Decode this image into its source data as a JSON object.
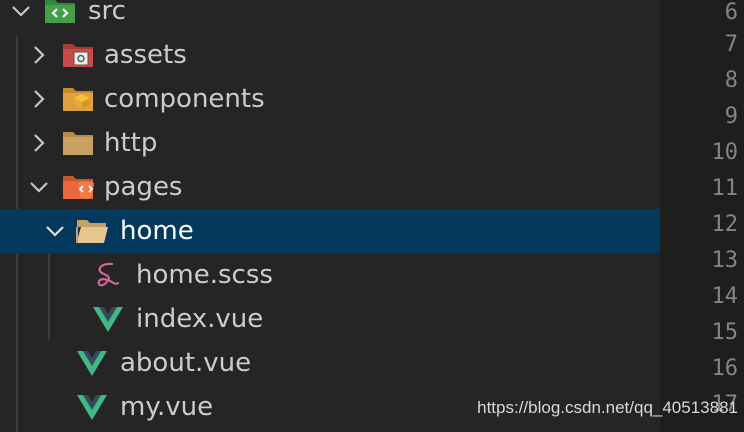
{
  "explorer": {
    "items": [
      {
        "label": "src",
        "type": "folder",
        "icon": "src-folder-icon",
        "expanded": true
      },
      {
        "label": "assets",
        "type": "folder",
        "icon": "assets-folder-icon",
        "expanded": false
      },
      {
        "label": "components",
        "type": "folder",
        "icon": "components-folder-icon",
        "expanded": false
      },
      {
        "label": "http",
        "type": "folder",
        "icon": "folder-icon",
        "expanded": false
      },
      {
        "label": "pages",
        "type": "folder",
        "icon": "pages-folder-icon",
        "expanded": true
      },
      {
        "label": "home",
        "type": "folder",
        "icon": "folder-open-icon",
        "expanded": true,
        "selected": true
      },
      {
        "label": "home.scss",
        "type": "file",
        "icon": "sass-file-icon"
      },
      {
        "label": "index.vue",
        "type": "file",
        "icon": "vue-file-icon"
      },
      {
        "label": "about.vue",
        "type": "file",
        "icon": "vue-file-icon"
      },
      {
        "label": "my.vue",
        "type": "file",
        "icon": "vue-file-icon"
      }
    ]
  },
  "gutter": {
    "line_numbers": [
      "6",
      "7",
      "8",
      "9",
      "10",
      "11",
      "12",
      "13",
      "14",
      "15",
      "16",
      "17"
    ]
  },
  "watermark": "https://blog.csdn.net/qq_40513881",
  "colors": {
    "panel": "#252526",
    "editor": "#1e1e1e",
    "selection": "#04395e",
    "text": "#cccccc",
    "line_number": "#858585",
    "vue_green": "#41b883",
    "sass_pink": "#cd6799"
  }
}
